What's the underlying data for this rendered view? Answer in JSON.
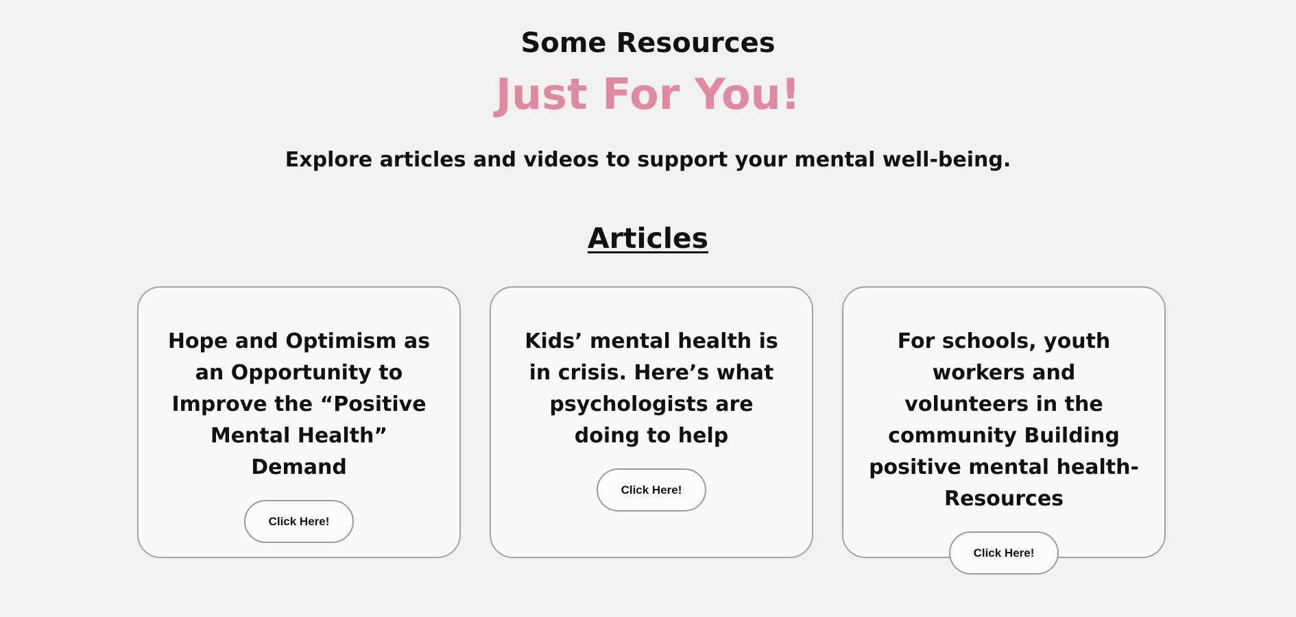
{
  "colors": {
    "background": "#f2f1f1",
    "accent": "#df8aa3",
    "text": "#111111",
    "card_border": "#a3a3a3"
  },
  "hero": {
    "kicker": "Some Resources",
    "title": "Just For You!",
    "subtitle": "Explore articles and videos to support your mental well-being."
  },
  "articles": {
    "heading": "Articles",
    "cards": [
      {
        "title": "Hope and Optimism as an Opportunity to Improve the “Positive Mental Health” Demand",
        "button_label": "Click Here!"
      },
      {
        "title": "Kids’ mental health is in crisis. Here’s what psychologists are doing to help",
        "button_label": "Click Here!"
      },
      {
        "title": "For schools, youth workers and volunteers in the community Building positive mental health-Resources",
        "button_label": "Click Here!"
      }
    ]
  }
}
